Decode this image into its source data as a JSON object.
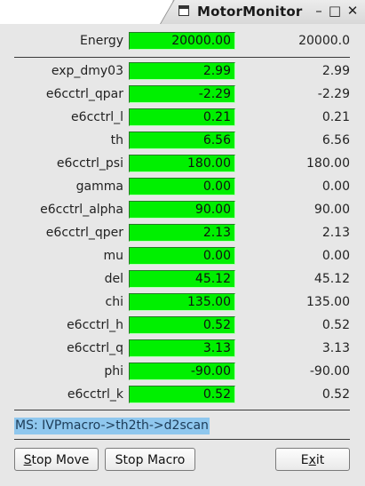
{
  "window": {
    "title": "MotorMonitor",
    "minimize_glyph": "–",
    "maximize_glyph": "□",
    "close_glyph": "✕"
  },
  "energy": {
    "label": "Energy",
    "setpoint": "20000.00",
    "readback": "20000.0"
  },
  "motors": [
    {
      "label": "exp_dmy03",
      "setpoint": "2.99",
      "readback": "2.99"
    },
    {
      "label": "e6cctrl_qpar",
      "setpoint": "-2.29",
      "readback": "-2.29"
    },
    {
      "label": "e6cctrl_l",
      "setpoint": "0.21",
      "readback": "0.21"
    },
    {
      "label": "th",
      "setpoint": "6.56",
      "readback": "6.56"
    },
    {
      "label": "e6cctrl_psi",
      "setpoint": "180.00",
      "readback": "180.00"
    },
    {
      "label": "gamma",
      "setpoint": "0.00",
      "readback": "0.00"
    },
    {
      "label": "e6cctrl_alpha",
      "setpoint": "90.00",
      "readback": "90.00"
    },
    {
      "label": "e6cctrl_qper",
      "setpoint": "2.13",
      "readback": "2.13"
    },
    {
      "label": "mu",
      "setpoint": "0.00",
      "readback": "0.00"
    },
    {
      "label": "del",
      "setpoint": "45.12",
      "readback": "45.12"
    },
    {
      "label": "chi",
      "setpoint": "135.00",
      "readback": "135.00"
    },
    {
      "label": "e6cctrl_h",
      "setpoint": "0.52",
      "readback": "0.52"
    },
    {
      "label": "e6cctrl_q",
      "setpoint": "3.13",
      "readback": "3.13"
    },
    {
      "label": "phi",
      "setpoint": "-90.00",
      "readback": "-90.00"
    },
    {
      "label": "e6cctrl_k",
      "setpoint": "0.52",
      "readback": "0.52"
    }
  ],
  "status": {
    "text": "MS: IVPmacro->th2th->d2scan"
  },
  "buttons": {
    "stop_move": {
      "mnemonic": "S",
      "rest": "top Move"
    },
    "stop_macro": {
      "label": "Stop Macro"
    },
    "exit": {
      "pre": "E",
      "mnemonic": "x",
      "rest": "it"
    }
  },
  "colors": {
    "field_background": "#00f000",
    "status_highlight": "#8fc7ee"
  }
}
